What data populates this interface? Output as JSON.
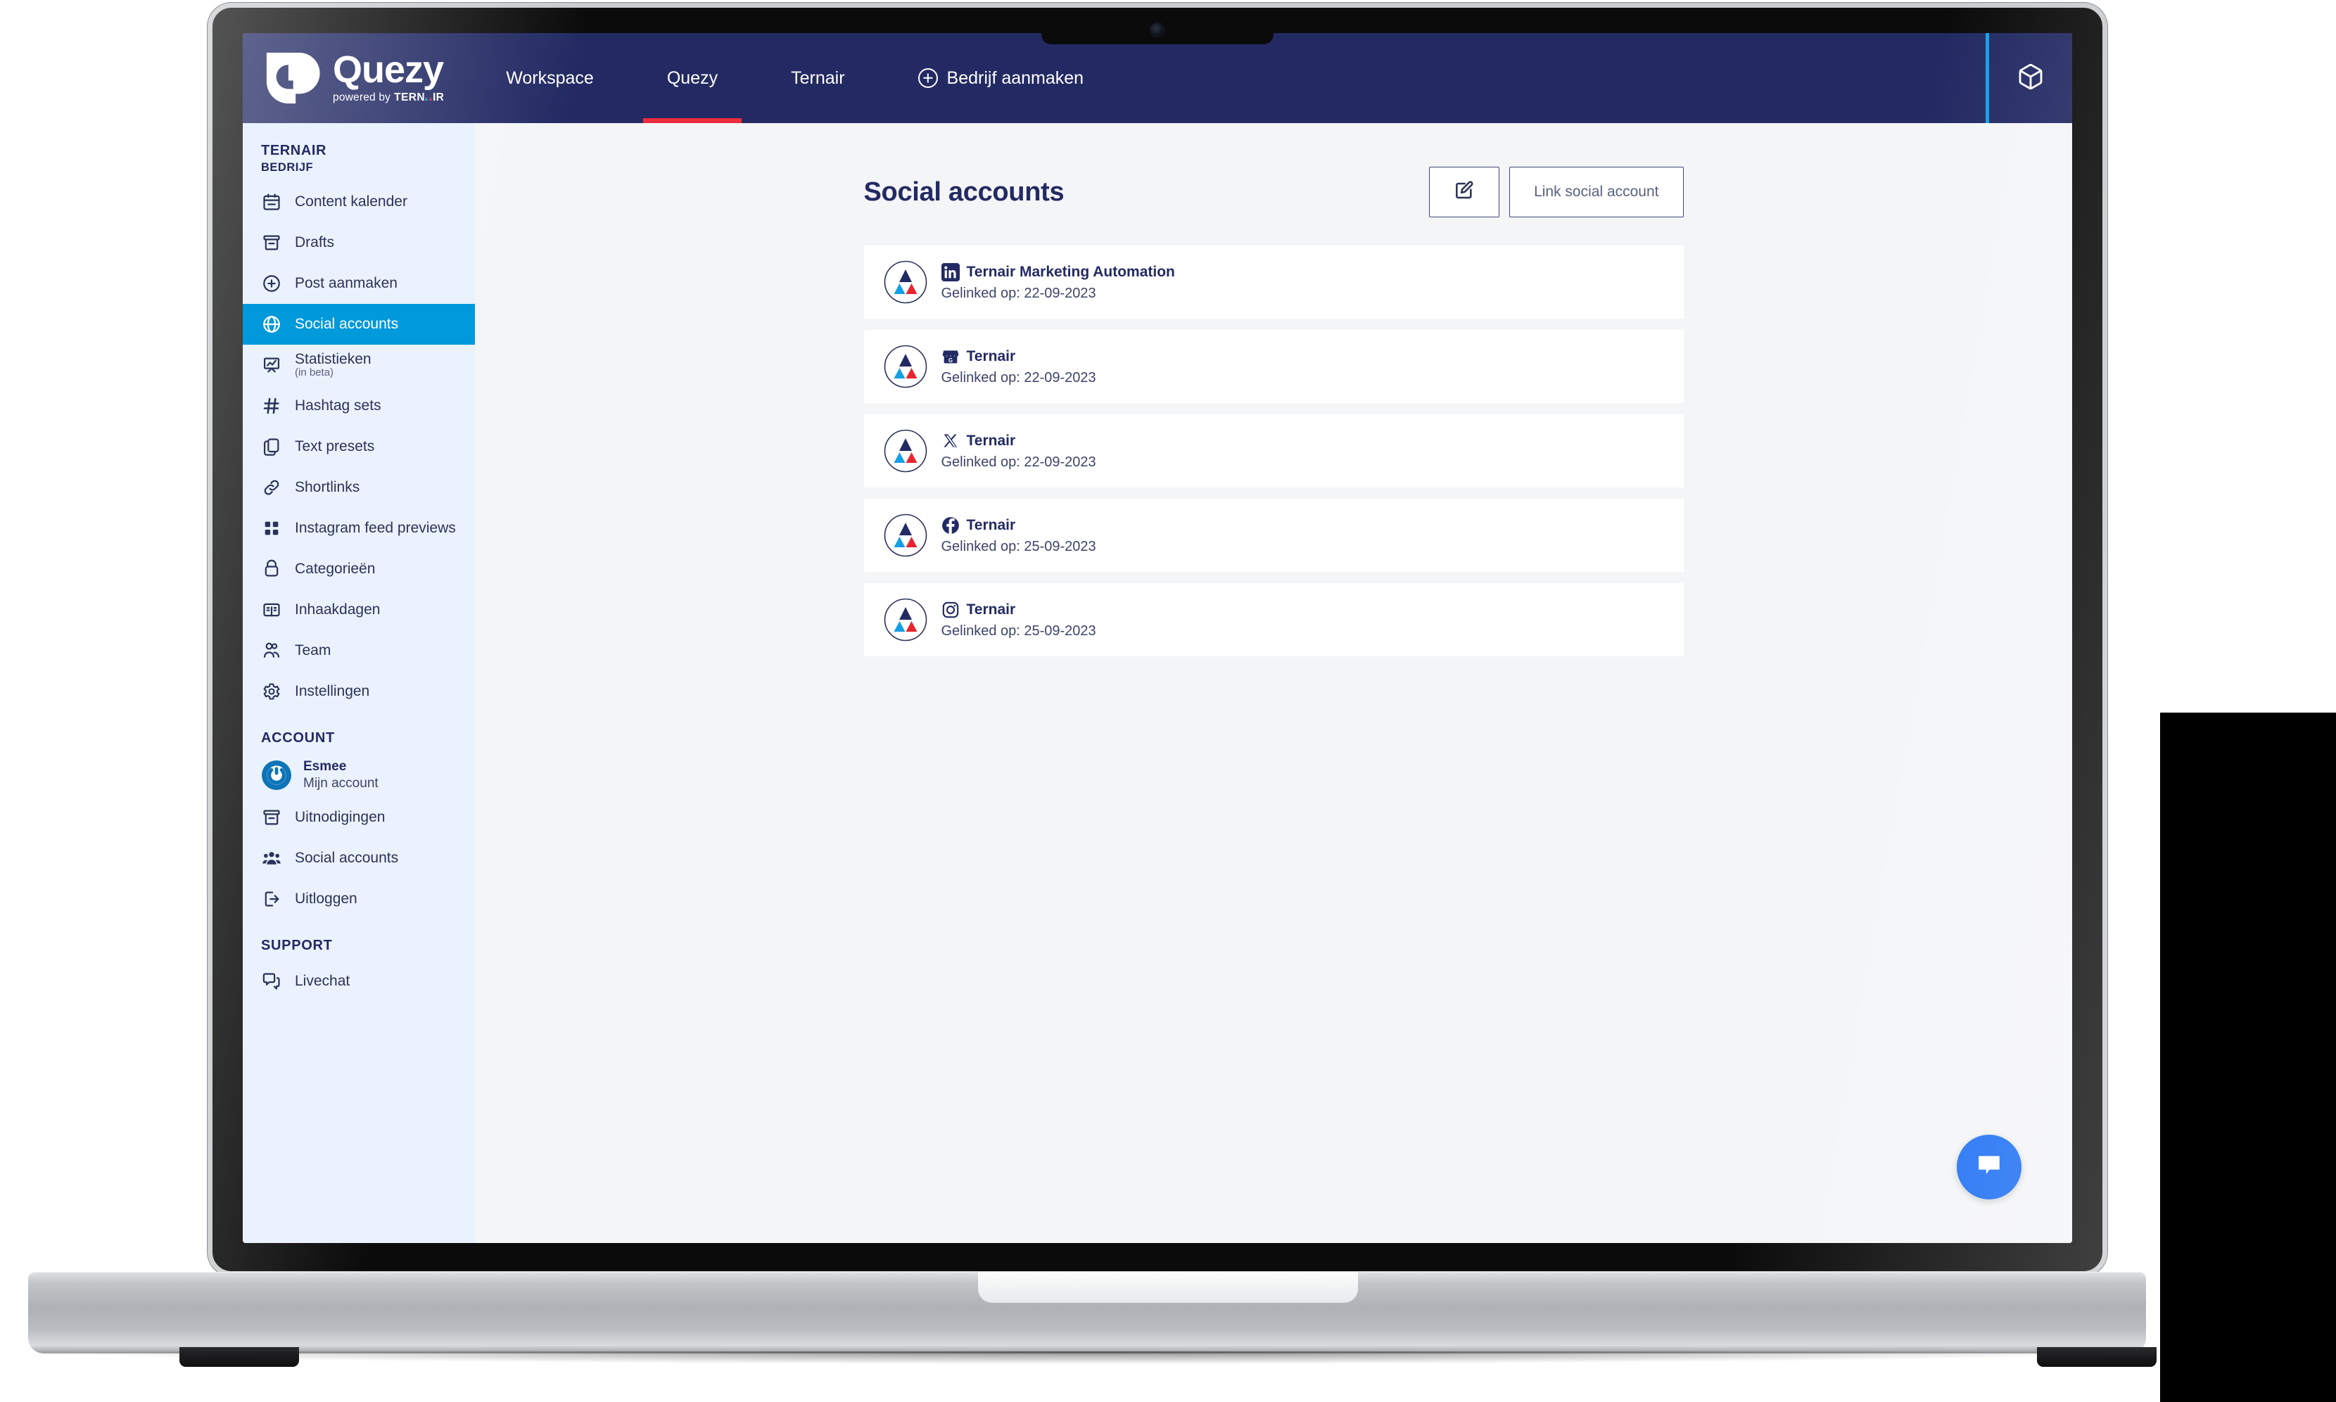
{
  "brand": {
    "name": "Quezy",
    "powered_prefix": "powered by",
    "powered_brand_pre": "TERN",
    "powered_brand_post": "IR"
  },
  "topnav": {
    "items": [
      {
        "label": "Workspace",
        "active": false,
        "icon": ""
      },
      {
        "label": "Quezy",
        "active": true,
        "icon": ""
      },
      {
        "label": "Ternair",
        "active": false,
        "icon": ""
      },
      {
        "label": "Bedrijf aanmaken",
        "active": false,
        "icon": "plus-circle-icon"
      }
    ],
    "right_icon": "cube-icon",
    "bar_color": "#232a63",
    "active_underline_color": "#ee2c3c",
    "divider_color": "#14a0e2"
  },
  "sidebar": {
    "org_name": "TERNAIR",
    "org_type": "BEDRIJF",
    "bg_color": "#eaf2fd",
    "active_color": "#0099da",
    "items": [
      {
        "label": "Content kalender",
        "icon": "calendar-icon",
        "active": false,
        "sub": ""
      },
      {
        "label": "Drafts",
        "icon": "archive-icon",
        "active": false,
        "sub": ""
      },
      {
        "label": "Post aanmaken",
        "icon": "plus-circle-icon",
        "active": false,
        "sub": ""
      },
      {
        "label": "Social accounts",
        "icon": "globe-icon",
        "active": true,
        "sub": ""
      },
      {
        "label": "Statistieken",
        "icon": "presentation-chart-icon",
        "active": false,
        "sub": "(in beta)"
      },
      {
        "label": "Hashtag sets",
        "icon": "hashtag-icon",
        "active": false,
        "sub": ""
      },
      {
        "label": "Text presets",
        "icon": "copy-icon",
        "active": false,
        "sub": ""
      },
      {
        "label": "Shortlinks",
        "icon": "link-icon",
        "active": false,
        "sub": ""
      },
      {
        "label": "Instagram feed previews",
        "icon": "grid-icon",
        "active": false,
        "sub": ""
      },
      {
        "label": "Categorieën",
        "icon": "box-icon",
        "active": false,
        "sub": ""
      },
      {
        "label": "Inhaakdagen",
        "icon": "book-open-icon",
        "active": false,
        "sub": ""
      },
      {
        "label": "Team",
        "icon": "users-icon",
        "active": false,
        "sub": ""
      },
      {
        "label": "Instellingen",
        "icon": "gear-icon",
        "active": false,
        "sub": ""
      }
    ],
    "account_section_title": "ACCOUNT",
    "account_user_name": "Esmee",
    "account_user_sub": "Mijn account",
    "account_items": [
      {
        "label": "Uitnodigingen",
        "icon": "archive-icon"
      },
      {
        "label": "Social accounts",
        "icon": "users-group-icon"
      },
      {
        "label": "Uitloggen",
        "icon": "logout-icon"
      }
    ],
    "support_section_title": "SUPPORT",
    "support_items": [
      {
        "label": "Livechat",
        "icon": "chat-icon"
      }
    ]
  },
  "main": {
    "page_title": "Social accounts",
    "edit_button_icon": "edit-square-icon",
    "link_button_label": "Link social account",
    "accounts": [
      {
        "platform": "linkedin",
        "name": "Ternair Marketing Automation",
        "linked_label": "Gelinked op: 22-09-2023"
      },
      {
        "platform": "google-business",
        "name": "Ternair",
        "linked_label": "Gelinked op: 22-09-2023"
      },
      {
        "platform": "x-twitter",
        "name": "Ternair",
        "linked_label": "Gelinked op: 22-09-2023"
      },
      {
        "platform": "facebook",
        "name": "Ternair",
        "linked_label": "Gelinked op: 25-09-2023"
      },
      {
        "platform": "instagram",
        "name": "Ternair",
        "linked_label": "Gelinked op: 25-09-2023"
      }
    ],
    "chat_fab_icon": "chat-bubble-icon",
    "chat_fab_color": "#1b6ef3"
  }
}
